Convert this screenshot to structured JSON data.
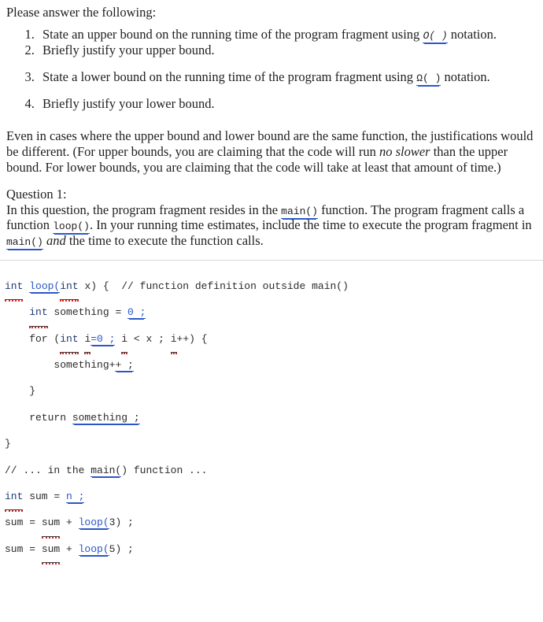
{
  "document": {
    "lead": "Please answer the following:",
    "questions": [
      {
        "index": "1.",
        "text_before": "State an upper bound on the running time of the program fragment using ",
        "code": "O( )",
        "text_after": " notation."
      },
      {
        "index": "2.",
        "text_before": "Briefly justify your upper bound.",
        "code": "",
        "text_after": ""
      },
      {
        "index": "3.",
        "text_before": "State a lower bound on the running time of the program fragment using ",
        "code": "Ω( )",
        "text_after": " notation."
      },
      {
        "index": "4.",
        "text_before": "Briefly justify your lower bound.",
        "code": "",
        "text_after": ""
      }
    ],
    "paragraph_even": {
      "part1": "Even in cases where the upper bound and lower bound are the same function, the justifications would be different. (For upper bounds, you are claiming that the code will run ",
      "italic": "no slower",
      "part2": " than the upper bound. For lower bounds, you are claiming that the code will take at least that amount of time.)"
    },
    "question_heading": "Question 1:",
    "paragraph_q1": {
      "part1": "In this question, the program fragment resides in the ",
      "code1": "main()",
      "part2": " function. The program fragment calls a function ",
      "code2": "loop()",
      "part3": ". In your running time estimates, include the time to execute the program fragment in ",
      "code3": "main()",
      "part4_italic": "and",
      "part5": " the time to execute the function calls."
    }
  },
  "code": {
    "lines": [
      {
        "id": "line-1",
        "text": "int loop(int x) {  // function definition outside main()",
        "tokens": [
          {
            "t": "int",
            "style": "kw-underline-squiggle"
          },
          {
            "t": " ",
            "style": "plain"
          },
          {
            "t": "loop(",
            "style": "blue-double"
          },
          {
            "t": "int",
            "style": "kw-underline-squiggle"
          },
          {
            "t": " x) {  // function definition outside main()",
            "style": "plain"
          }
        ]
      },
      {
        "id": "line-2",
        "text": "    int something = 0 ;",
        "tokens": [
          {
            "t": "    ",
            "style": "plain"
          },
          {
            "t": "int",
            "style": "kw-underline-squiggle"
          },
          {
            "t": " something = ",
            "style": "plain"
          },
          {
            "t": "0 ;",
            "style": "blue-double"
          }
        ]
      },
      {
        "id": "line-3",
        "text": "    for (int i=0 ; i < x ; i++) {",
        "tokens": [
          {
            "t": "    for (",
            "style": "plain"
          },
          {
            "t": "int",
            "style": "kw-underline-squiggle"
          },
          {
            "t": " ",
            "style": "plain"
          },
          {
            "t": "i",
            "style": "underline-squiggle"
          },
          {
            "t": "=0 ;",
            "style": "blue-double"
          },
          {
            "t": " ",
            "style": "plain"
          },
          {
            "t": "i",
            "style": "underline-squiggle"
          },
          {
            "t": " < x ; ",
            "style": "plain"
          },
          {
            "t": "i",
            "style": "underline-squiggle"
          },
          {
            "t": "++) {",
            "style": "plain"
          }
        ]
      },
      {
        "id": "line-4",
        "text": "        something++ ;",
        "tokens": [
          {
            "t": "        something+",
            "style": "plain"
          },
          {
            "t": "+ ;",
            "style": "blue-double-dark"
          }
        ]
      },
      {
        "id": "line-5",
        "text": "    }",
        "tokens": [
          {
            "t": "    }",
            "style": "plain"
          }
        ]
      },
      {
        "id": "line-6",
        "text": "    return something ;",
        "tokens": [
          {
            "t": "    return ",
            "style": "plain"
          },
          {
            "t": "something ;",
            "style": "blue-double-dark"
          }
        ]
      },
      {
        "id": "line-7",
        "text": "}",
        "tokens": [
          {
            "t": "}",
            "style": "plain"
          }
        ]
      },
      {
        "id": "line-8",
        "text": "// ... in the main() function ...",
        "tokens": [
          {
            "t": "// ... in the ",
            "style": "plain"
          },
          {
            "t": "main(",
            "style": "blue-double-dark"
          },
          {
            "t": ") function ...",
            "style": "plain"
          }
        ]
      },
      {
        "id": "line-9",
        "text": "int sum = n ;",
        "tokens": [
          {
            "t": "int",
            "style": "kw-underline-squiggle"
          },
          {
            "t": " sum = ",
            "style": "plain"
          },
          {
            "t": "n ;",
            "style": "blue-double"
          }
        ]
      },
      {
        "id": "line-10",
        "text": "sum = sum + loop(3) ;",
        "tokens": [
          {
            "t": "sum = ",
            "style": "plain"
          },
          {
            "t": "sum",
            "style": "underline-squiggle"
          },
          {
            "t": " + ",
            "style": "plain"
          },
          {
            "t": "loop(",
            "style": "blue-double"
          },
          {
            "t": "3) ;",
            "style": "plain"
          }
        ]
      },
      {
        "id": "line-11",
        "text": "sum = sum + loop(5) ;",
        "tokens": [
          {
            "t": "sum = ",
            "style": "plain"
          },
          {
            "t": "sum",
            "style": "underline-squiggle"
          },
          {
            "t": " + ",
            "style": "plain"
          },
          {
            "t": "loop(",
            "style": "blue-double"
          },
          {
            "t": "5) ;",
            "style": "plain"
          }
        ]
      }
    ]
  },
  "colors": {
    "text": "#1f1f1f",
    "code_text": "#2b2b2b",
    "keyword_blue": "#203b73",
    "link_blue": "#2a56c6",
    "spellcheck_red": "#e02020",
    "rule_gray": "#d8d8d8",
    "background": "#ffffff"
  }
}
